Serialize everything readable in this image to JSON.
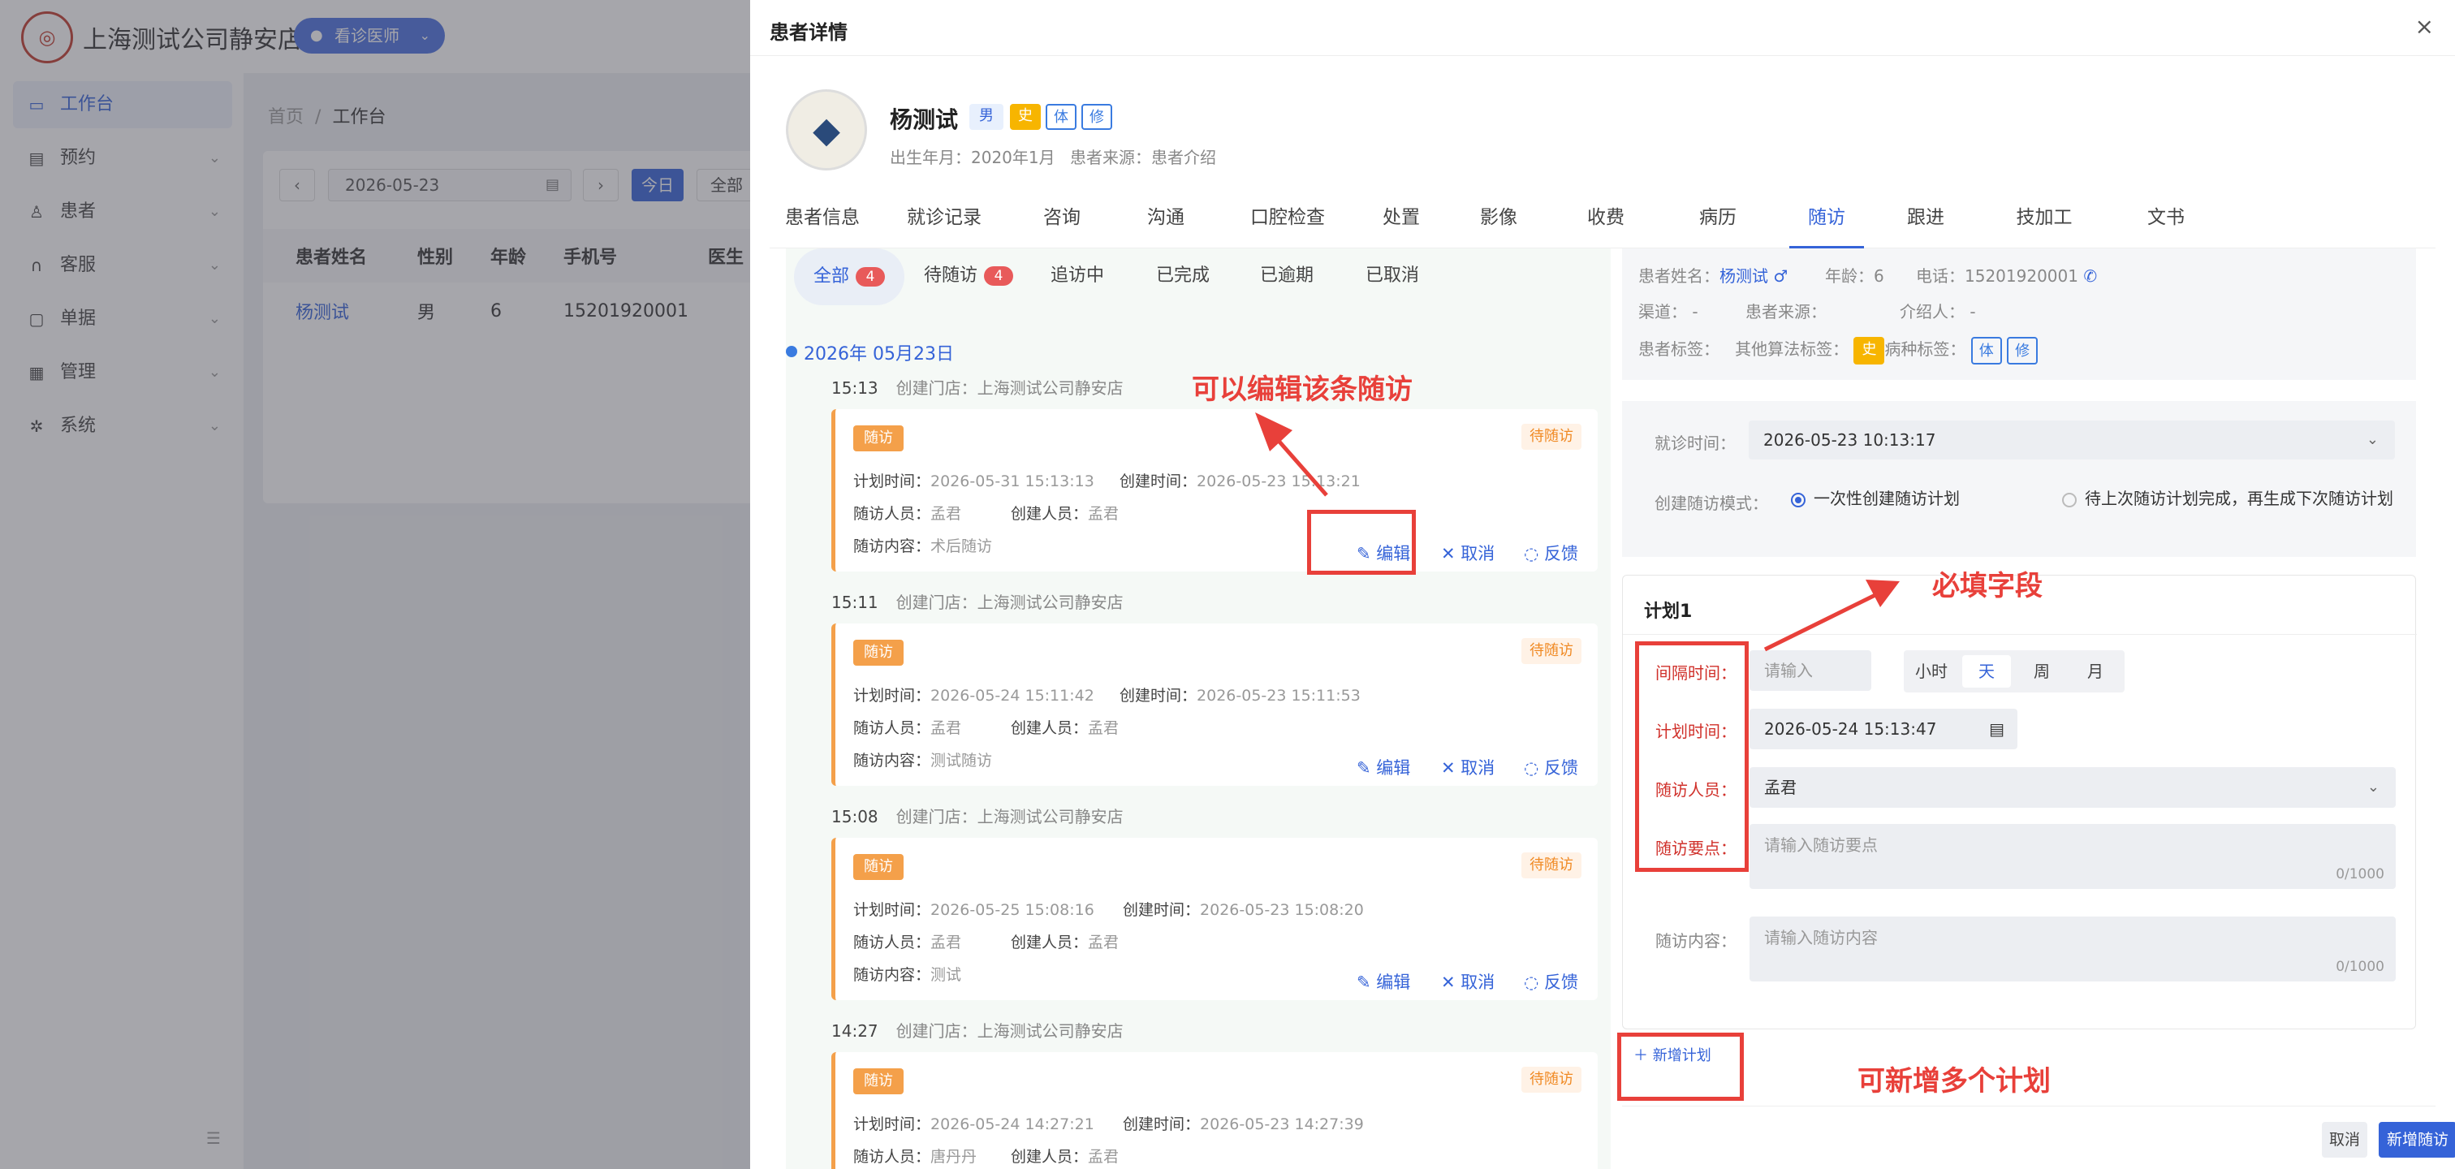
{
  "app": {
    "brand": "上海测试公司静安店",
    "role": "看诊医师",
    "logo_icon": "clinic-logo-icon",
    "nav": [
      {
        "label": "工作台",
        "icon": "monitor-icon",
        "active": true
      },
      {
        "label": "预约",
        "icon": "calendar-icon"
      },
      {
        "label": "患者",
        "icon": "user-icon"
      },
      {
        "label": "客服",
        "icon": "headset-icon"
      },
      {
        "label": "单据",
        "icon": "document-icon"
      },
      {
        "label": "管理",
        "icon": "grid-icon"
      },
      {
        "label": "系统",
        "icon": "gear-icon"
      }
    ],
    "breadcrumb": {
      "home": "首页",
      "sep": "/",
      "current": "工作台"
    },
    "toolbar": {
      "date": "2026-05-23",
      "today": "今日",
      "all": "全部"
    },
    "table": {
      "headers": [
        "患者姓名",
        "性别",
        "年龄",
        "手机号",
        "医生"
      ],
      "rows": [
        [
          "杨测试",
          "男",
          "6",
          "15201920001",
          ""
        ]
      ]
    }
  },
  "drawer": {
    "title": "患者详情",
    "close": "×",
    "patient": {
      "name": "杨测试",
      "sex": "男",
      "tags": [
        "史",
        "体",
        "修"
      ],
      "birth": "出生年月：2020年1月",
      "source": "患者来源：患者介绍"
    },
    "tabs": [
      "患者信息",
      "就诊记录",
      "咨询",
      "沟通",
      "口腔检查",
      "处置",
      "影像",
      "收费",
      "病历",
      "随访",
      "跟进",
      "技加工",
      "文书"
    ],
    "active_tab": "随访",
    "subtabs": [
      {
        "label": "全部",
        "count": "4"
      },
      {
        "label": "待随访",
        "count": "4"
      },
      {
        "label": "追访中"
      },
      {
        "label": "已完成"
      },
      {
        "label": "已逾期"
      },
      {
        "label": "已取消"
      }
    ],
    "date_header": "2026年 05月23日",
    "labels": {
      "store": "创建门店：",
      "plan_time": "计划时间：",
      "create_time": "创建时间：",
      "follower": "随访人员：",
      "creator": "创建人员：",
      "content": "随访内容：",
      "edit": "编辑",
      "cancel": "取消",
      "feedback": "反馈",
      "tag": "随访",
      "status": "待随访"
    },
    "records": [
      {
        "time": "15:13",
        "store": "上海测试公司静安店",
        "plan": "2026-05-31 15:13:13",
        "created": "2026-05-23 15:13:21",
        "follower": "孟君",
        "creator": "孟君",
        "content": "术后随访"
      },
      {
        "time": "15:11",
        "store": "上海测试公司静安店",
        "plan": "2026-05-24 15:11:42",
        "created": "2026-05-23 15:11:53",
        "follower": "孟君",
        "creator": "孟君",
        "content": "测试随访"
      },
      {
        "time": "15:08",
        "store": "上海测试公司静安店",
        "plan": "2026-05-25 15:08:16",
        "created": "2026-05-23 15:08:20",
        "follower": "孟君",
        "creator": "孟君",
        "content": "测试"
      },
      {
        "time": "14:27",
        "store": "上海测试公司静安店",
        "plan": "2026-05-24 14:27:21",
        "created": "2026-05-23 14:27:39",
        "follower": "唐丹丹",
        "creator": "孟君",
        "content": ""
      }
    ],
    "info": {
      "name_label": "患者姓名：",
      "name": "杨测试",
      "age": "年龄：6",
      "phone": "电话：15201920001",
      "channel": "渠道： -",
      "source": "患者来源：",
      "referrer": "介绍人： -",
      "tags_label": "患者标签：",
      "algo_label": "其他算法标签：",
      "algo_tag": "史",
      "disease_label": "病种标签：",
      "disease_tags": [
        "体",
        "修"
      ]
    },
    "form": {
      "visit_label": "就诊时间：",
      "visit_value": "2026-05-23 10:13:17",
      "mode_label": "创建随访模式：",
      "mode_options": [
        "一次性创建随访计划",
        "待上次随访计划完成，再生成下次随访计划"
      ],
      "plan_title": "计划1",
      "interval_label": "间隔时间：",
      "interval_placeholder": "请输入",
      "units": [
        "小时",
        "天",
        "周",
        "月"
      ],
      "plan_time_label": "计划时间：",
      "plan_time_value": "2026-05-24 15:13:47",
      "follower_label": "随访人员：",
      "follower_value": "孟君",
      "points_label": "随访要点：",
      "points_placeholder": "请输入随访要点",
      "points_count": "0/1000",
      "content_label": "随访内容：",
      "content_placeholder": "请输入随访内容",
      "content_count": "0/1000",
      "add_plan": "新增计划",
      "cancel": "取消",
      "submit": "新增随访"
    }
  },
  "annotations": {
    "edit_hint": "可以编辑该条随访",
    "required_hint": "必填字段",
    "multi_hint": "可新增多个计划",
    "color": "#e8403a"
  }
}
